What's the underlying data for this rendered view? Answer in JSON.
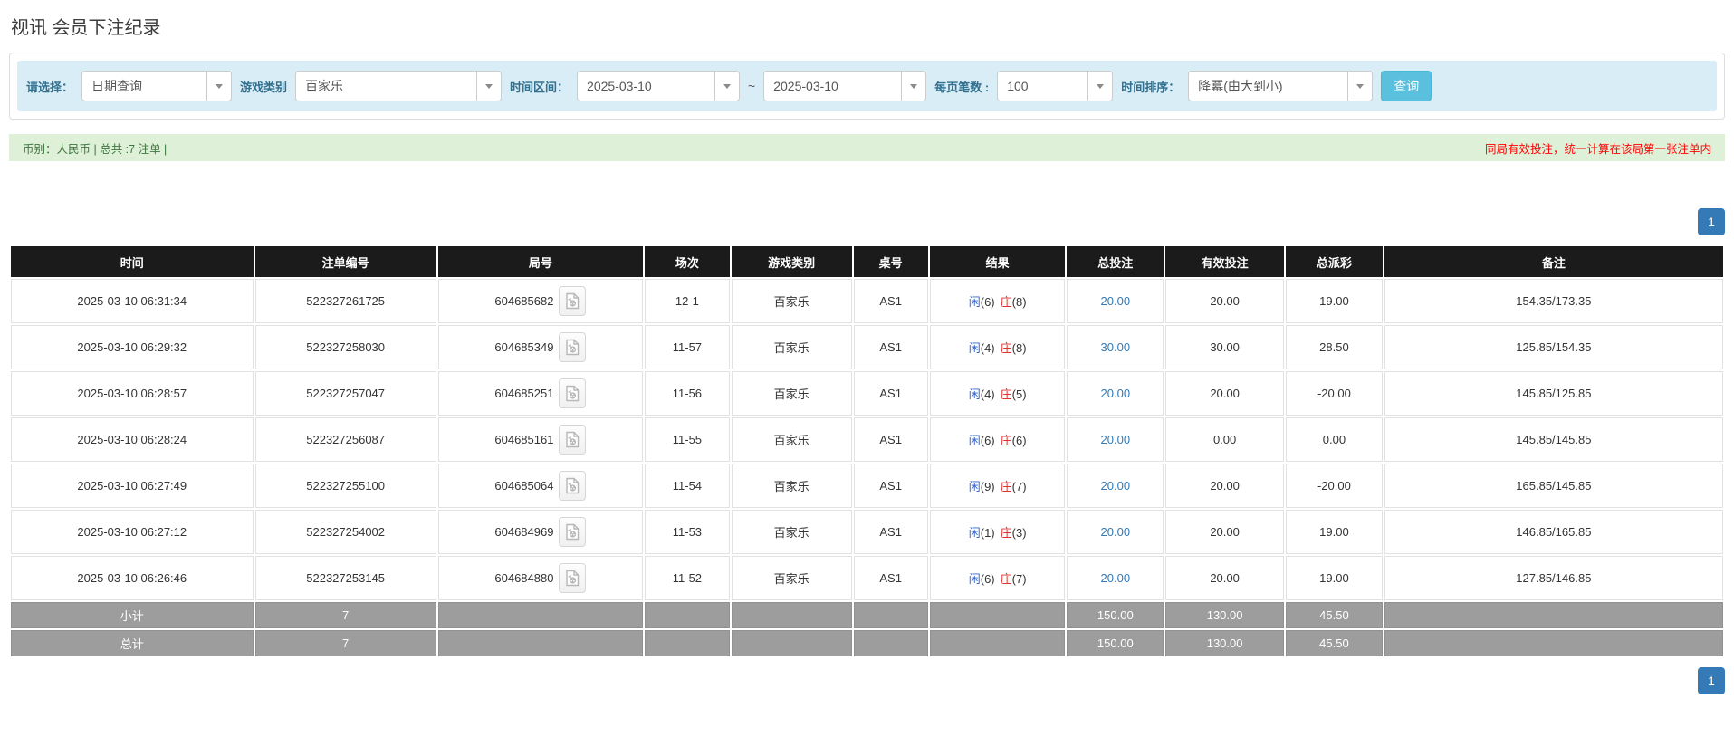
{
  "page": {
    "title": "视讯 会员下注纪录"
  },
  "filters": {
    "select_type": {
      "label": "请选择：",
      "value": "日期查询"
    },
    "game_type": {
      "label": "游戏类别",
      "value": "百家乐"
    },
    "date_range": {
      "label": "时间区间：",
      "from": "2025-03-10",
      "separator": "~",
      "to": "2025-03-10"
    },
    "page_size": {
      "label": "每页笔数 :",
      "value": "100"
    },
    "sort": {
      "label": "时间排序：",
      "value": "降冪(由大到小)"
    },
    "search_button": "查询"
  },
  "summary_bar": {
    "left": "币别：人民币 | 总共 :7 注单 |",
    "notice": "同局有效投注，统一计算在该局第一张注单内"
  },
  "pagination": {
    "page": "1"
  },
  "table": {
    "headers": [
      "时间",
      "注单编号",
      "局号",
      "场次",
      "游戏类别",
      "桌号",
      "结果",
      "总投注",
      "有效投注",
      "总派彩",
      "备注"
    ],
    "result_labels": {
      "player": "闲",
      "banker": "庄"
    },
    "rows": [
      {
        "time": "2025-03-10 06:31:34",
        "bet_id": "522327261725",
        "round_id": "604685682",
        "session": "12-1",
        "game_type": "百家乐",
        "table_no": "AS1",
        "player_score": "(6)",
        "banker_score": "(8)",
        "total_bet": "20.00",
        "valid_bet": "20.00",
        "payout": "19.00",
        "remark": "154.35/173.35"
      },
      {
        "time": "2025-03-10 06:29:32",
        "bet_id": "522327258030",
        "round_id": "604685349",
        "session": "11-57",
        "game_type": "百家乐",
        "table_no": "AS1",
        "player_score": "(4)",
        "banker_score": "(8)",
        "total_bet": "30.00",
        "valid_bet": "30.00",
        "payout": "28.50",
        "remark": "125.85/154.35"
      },
      {
        "time": "2025-03-10 06:28:57",
        "bet_id": "522327257047",
        "round_id": "604685251",
        "session": "11-56",
        "game_type": "百家乐",
        "table_no": "AS1",
        "player_score": "(4)",
        "banker_score": "(5)",
        "total_bet": "20.00",
        "valid_bet": "20.00",
        "payout": "-20.00",
        "remark": "145.85/125.85"
      },
      {
        "time": "2025-03-10 06:28:24",
        "bet_id": "522327256087",
        "round_id": "604685161",
        "session": "11-55",
        "game_type": "百家乐",
        "table_no": "AS1",
        "player_score": "(6)",
        "banker_score": "(6)",
        "total_bet": "20.00",
        "valid_bet": "0.00",
        "payout": "0.00",
        "remark": "145.85/145.85"
      },
      {
        "time": "2025-03-10 06:27:49",
        "bet_id": "522327255100",
        "round_id": "604685064",
        "session": "11-54",
        "game_type": "百家乐",
        "table_no": "AS1",
        "player_score": "(9)",
        "banker_score": "(7)",
        "total_bet": "20.00",
        "valid_bet": "20.00",
        "payout": "-20.00",
        "remark": "165.85/145.85"
      },
      {
        "time": "2025-03-10 06:27:12",
        "bet_id": "522327254002",
        "round_id": "604684969",
        "session": "11-53",
        "game_type": "百家乐",
        "table_no": "AS1",
        "player_score": "(1)",
        "banker_score": "(3)",
        "total_bet": "20.00",
        "valid_bet": "20.00",
        "payout": "19.00",
        "remark": "146.85/165.85"
      },
      {
        "time": "2025-03-10 06:26:46",
        "bet_id": "522327253145",
        "round_id": "604684880",
        "session": "11-52",
        "game_type": "百家乐",
        "table_no": "AS1",
        "player_score": "(6)",
        "banker_score": "(7)",
        "total_bet": "20.00",
        "valid_bet": "20.00",
        "payout": "19.00",
        "remark": "127.85/146.85"
      }
    ],
    "subtotal": {
      "label": "小计",
      "count": "7",
      "total_bet": "150.00",
      "valid_bet": "130.00",
      "payout": "45.50"
    },
    "total": {
      "label": "总计",
      "count": "7",
      "total_bet": "150.00",
      "valid_bet": "130.00",
      "payout": "45.50"
    }
  },
  "colors": {
    "accent": "#337ab7",
    "player": "#3366cc",
    "banker": "#dd3333",
    "neg": "#e60000",
    "notice": "#ff0000",
    "success-bg": "#dff0d8",
    "success-text": "#3c763d",
    "info-bg": "#d9edf7",
    "info-text": "#31708f",
    "btn-info": "#5bc0de",
    "header-bg": "#1b1b1b",
    "summary-bg": "#9d9d9d"
  }
}
